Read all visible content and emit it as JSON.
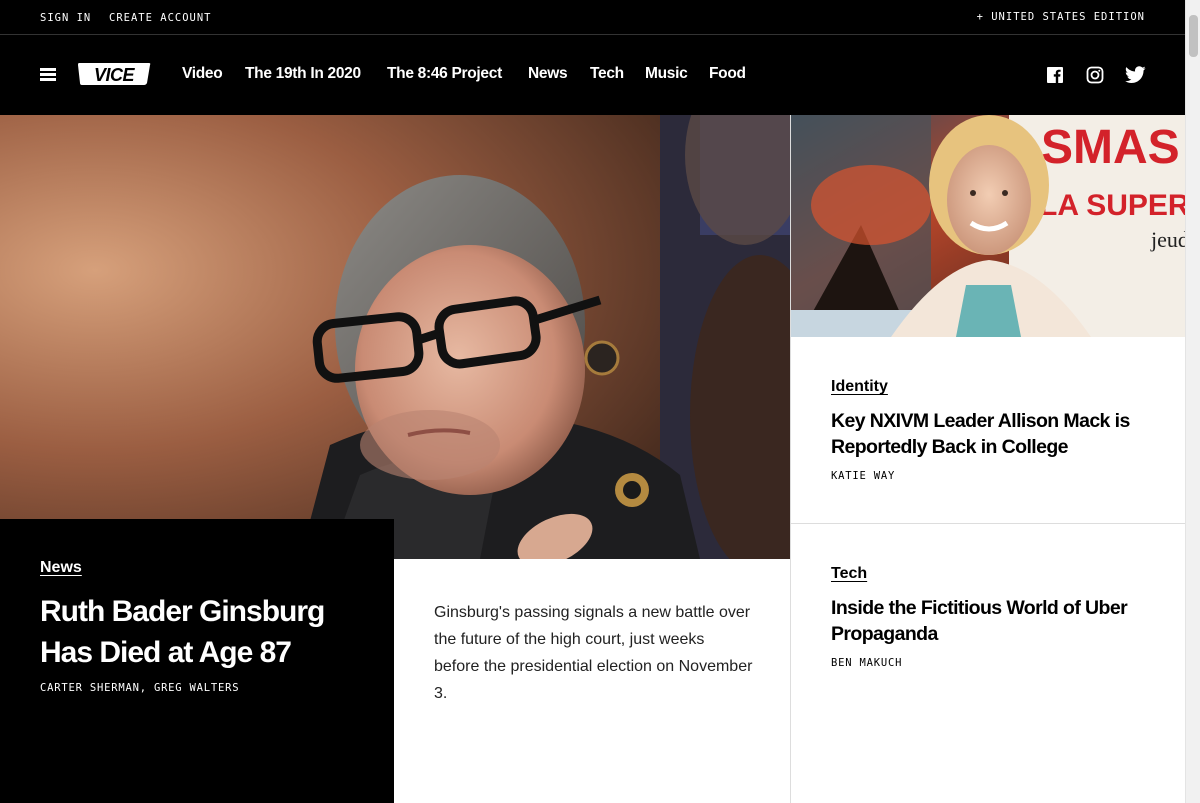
{
  "utility": {
    "sign_in": "SIGN IN",
    "create_account": "CREATE ACCOUNT",
    "edition": "+ UNITED STATES EDITION"
  },
  "nav": {
    "logo_icon": "vice-logo",
    "items": [
      "Video",
      "The 19th In 2020",
      "The 8:46 Project",
      "News",
      "Tech",
      "Music",
      "Food"
    ],
    "social": [
      "facebook-icon",
      "instagram-icon",
      "twitter-icon"
    ]
  },
  "hero": {
    "section": "News",
    "title": "Ruth Bader Ginsburg Has Died at Age 87",
    "authors": "CARTER SHERMAN, GREG WALTERS",
    "dek": "Ginsburg's passing signals a new battle over the future of the high court, just weeks before the presidential election on November 3."
  },
  "sidebar": {
    "stories": [
      {
        "section": "Identity",
        "title": "Key NXIVM Leader Allison Mack is Reportedly Back in College",
        "author": "KATIE WAY"
      },
      {
        "section": "Tech",
        "title": "Inside the Fictitious World of Uber Propaganda",
        "author": "BEN MAKUCH"
      }
    ]
  },
  "poster_text": {
    "line1": "SMAS",
    "line2": "LA SUPER N",
    "line3": "jeud"
  },
  "colors": {
    "background": "#000000",
    "text_light": "#ffffff",
    "text_dark": "#000000"
  }
}
